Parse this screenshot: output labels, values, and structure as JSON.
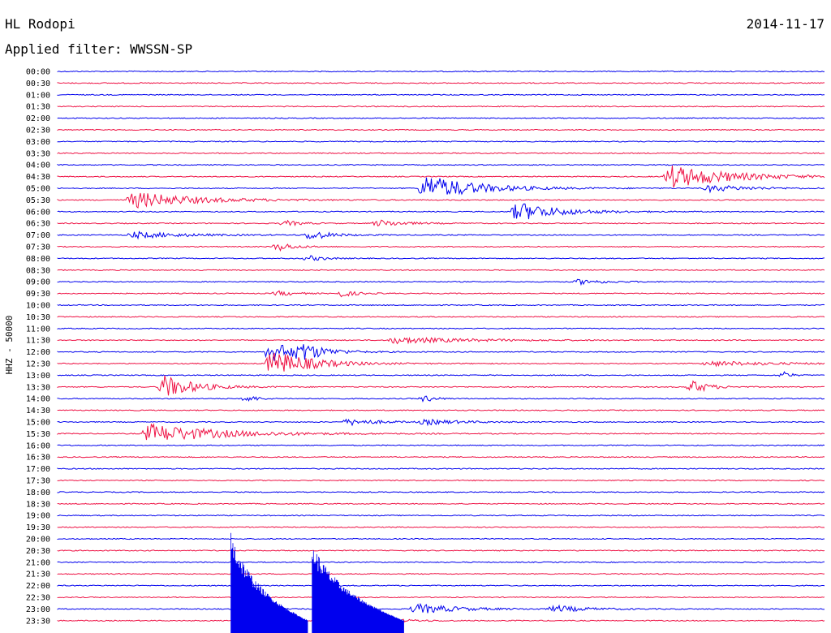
{
  "header": {
    "station": "HL Rodopi",
    "date": "2014-11-17",
    "filter_label": "Applied filter: WWSSN-SP"
  },
  "chart_data": {
    "type": "line",
    "ylabel": "HHZ - 50000",
    "colors": [
      "#0000ee",
      "#ee1144"
    ],
    "rows": [
      {
        "time": "00:00",
        "color": "#0000ee",
        "events": []
      },
      {
        "time": "00:30",
        "color": "#ee1144",
        "events": []
      },
      {
        "time": "01:00",
        "color": "#0000ee",
        "events": []
      },
      {
        "time": "01:30",
        "color": "#ee1144",
        "events": []
      },
      {
        "time": "02:00",
        "color": "#0000ee",
        "events": []
      },
      {
        "time": "02:30",
        "color": "#ee1144",
        "events": []
      },
      {
        "time": "03:00",
        "color": "#0000ee",
        "events": []
      },
      {
        "time": "03:30",
        "color": "#ee1144",
        "events": []
      },
      {
        "time": "04:00",
        "color": "#0000ee",
        "events": []
      },
      {
        "time": "04:30",
        "color": "#ee1144",
        "events": [
          [
            0.8,
            0.12,
            14
          ]
        ]
      },
      {
        "time": "05:00",
        "color": "#0000ee",
        "events": [
          [
            0.48,
            0.1,
            16
          ],
          [
            0.85,
            0.08,
            4
          ]
        ]
      },
      {
        "time": "05:30",
        "color": "#ee1144",
        "events": [
          [
            0.1,
            0.12,
            10
          ]
        ]
      },
      {
        "time": "06:00",
        "color": "#0000ee",
        "events": [
          [
            0.6,
            0.08,
            12
          ]
        ]
      },
      {
        "time": "06:30",
        "color": "#ee1144",
        "events": [
          [
            0.42,
            0.05,
            4
          ],
          [
            0.3,
            0.03,
            3
          ]
        ]
      },
      {
        "time": "07:00",
        "color": "#0000ee",
        "events": [
          [
            0.1,
            0.1,
            4
          ],
          [
            0.33,
            0.04,
            6
          ]
        ]
      },
      {
        "time": "07:30",
        "color": "#ee1144",
        "events": [
          [
            0.29,
            0.03,
            5
          ]
        ]
      },
      {
        "time": "08:00",
        "color": "#0000ee",
        "events": [
          [
            0.33,
            0.03,
            3
          ]
        ]
      },
      {
        "time": "08:30",
        "color": "#ee1144",
        "events": []
      },
      {
        "time": "09:00",
        "color": "#0000ee",
        "events": [
          [
            0.68,
            0.05,
            3
          ]
        ]
      },
      {
        "time": "09:30",
        "color": "#ee1144",
        "events": [
          [
            0.37,
            0.03,
            4
          ],
          [
            0.29,
            0.03,
            3
          ]
        ]
      },
      {
        "time": "10:00",
        "color": "#0000ee",
        "events": []
      },
      {
        "time": "10:30",
        "color": "#ee1144",
        "events": []
      },
      {
        "time": "11:00",
        "color": "#0000ee",
        "events": []
      },
      {
        "time": "11:30",
        "color": "#ee1144",
        "events": [
          [
            0.44,
            0.14,
            4
          ]
        ]
      },
      {
        "time": "12:00",
        "color": "#0000ee",
        "events": [
          [
            0.28,
            0.06,
            12
          ],
          [
            0.32,
            0.04,
            8
          ]
        ]
      },
      {
        "time": "12:30",
        "color": "#ee1144",
        "events": [
          [
            0.28,
            0.08,
            16
          ],
          [
            0.85,
            0.13,
            3
          ]
        ]
      },
      {
        "time": "13:00",
        "color": "#0000ee",
        "events": [
          [
            0.95,
            0.01,
            5
          ]
        ]
      },
      {
        "time": "13:30",
        "color": "#ee1144",
        "events": [
          [
            0.14,
            0.06,
            14
          ],
          [
            0.83,
            0.03,
            8
          ]
        ]
      },
      {
        "time": "14:00",
        "color": "#0000ee",
        "events": [
          [
            0.25,
            0.02,
            4
          ],
          [
            0.48,
            0.02,
            4
          ]
        ]
      },
      {
        "time": "14:30",
        "color": "#ee1144",
        "events": []
      },
      {
        "time": "15:00",
        "color": "#0000ee",
        "events": [
          [
            0.38,
            0.06,
            4
          ],
          [
            0.48,
            0.07,
            3
          ]
        ]
      },
      {
        "time": "15:30",
        "color": "#ee1144",
        "events": [
          [
            0.12,
            0.14,
            12
          ]
        ]
      },
      {
        "time": "16:00",
        "color": "#0000ee",
        "events": []
      },
      {
        "time": "16:30",
        "color": "#ee1144",
        "events": []
      },
      {
        "time": "17:00",
        "color": "#0000ee",
        "events": []
      },
      {
        "time": "17:30",
        "color": "#ee1144",
        "events": []
      },
      {
        "time": "18:00",
        "color": "#0000ee",
        "events": []
      },
      {
        "time": "18:30",
        "color": "#ee1144",
        "events": []
      },
      {
        "time": "19:00",
        "color": "#0000ee",
        "events": []
      },
      {
        "time": "19:30",
        "color": "#ee1144",
        "events": []
      },
      {
        "time": "20:00",
        "color": "#0000ee",
        "events": []
      },
      {
        "time": "20:30",
        "color": "#ee1144",
        "events": []
      },
      {
        "time": "21:00",
        "color": "#0000ee",
        "events": []
      },
      {
        "time": "21:30",
        "color": "#ee1144",
        "events": []
      },
      {
        "time": "22:00",
        "color": "#0000ee",
        "events": []
      },
      {
        "time": "22:30",
        "color": "#ee1144",
        "events": []
      },
      {
        "time": "23:00",
        "color": "#0000ee",
        "events": [
          [
            0.47,
            0.08,
            6
          ],
          [
            0.65,
            0.06,
            4
          ]
        ]
      },
      {
        "time": "23:30",
        "color": "#ee1144",
        "events": [
          [
            0.38,
            0.06,
            8
          ]
        ]
      }
    ],
    "large_quakes": [
      {
        "start_row": "20:00",
        "x": 0.226,
        "peak_amplitude": 140,
        "decay_width": 0.1
      },
      {
        "start_row": "20:00",
        "x": 0.332,
        "peak_amplitude": 110,
        "decay_width": 0.12
      }
    ]
  }
}
